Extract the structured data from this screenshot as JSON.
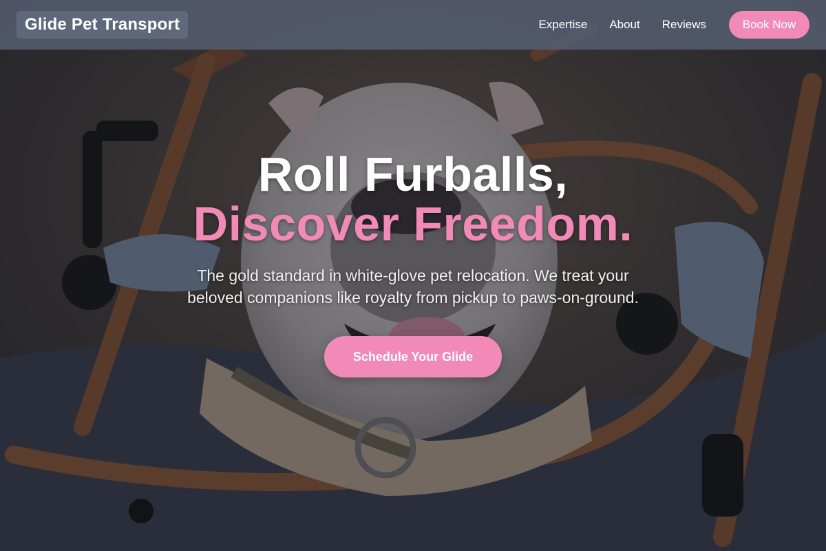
{
  "nav": {
    "brand": "Glide Pet Transport",
    "links": [
      "Expertise",
      "About",
      "Reviews"
    ],
    "cta": "Book Now"
  },
  "hero": {
    "headline_line1": "Roll Furballs,",
    "headline_line2": "Discover Freedom.",
    "subtext": "The gold standard in white-glove pet relocation. We treat your beloved companions like royalty from pickup to paws-on-ground.",
    "cta": "Schedule Your Glide"
  },
  "colors": {
    "accent": "#f28ab7",
    "nav_bg": "#545c6e",
    "text_light": "#ffffff"
  }
}
